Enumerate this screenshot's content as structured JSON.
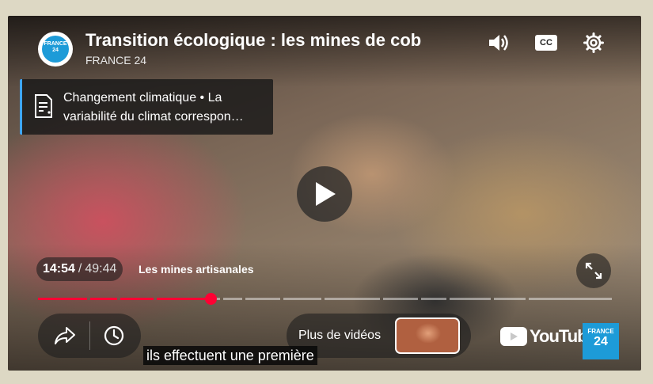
{
  "header": {
    "title": "Transition écologique : les mines de cob",
    "channel": "FRANCE 24",
    "logo_text": "FRANCE 24"
  },
  "info_card": {
    "line1": "Changement climatique • La",
    "line2": "variabilité du climat correspon…"
  },
  "player": {
    "current_time": "14:54",
    "separator": "/",
    "duration": "49:44",
    "chapter": "Les mines artisanales",
    "progress_fraction": 0.3,
    "more_videos_label": "Plus de vidéos",
    "caption": "ils effectuent une première",
    "youtube_label": "YouTube",
    "brand_line1": "FRANCE",
    "brand_line2": "24"
  },
  "icons": [
    "volume-icon",
    "closed-captions-icon",
    "settings-gear-icon",
    "document-icon",
    "play-icon",
    "fullscreen-icon",
    "share-arrow-icon",
    "watch-later-clock-icon",
    "youtube-play-icon"
  ],
  "colors": {
    "progress_played": "#ff0033",
    "info_card_accent": "#3ea6ff",
    "brand_blue": "#1d9bd8"
  }
}
